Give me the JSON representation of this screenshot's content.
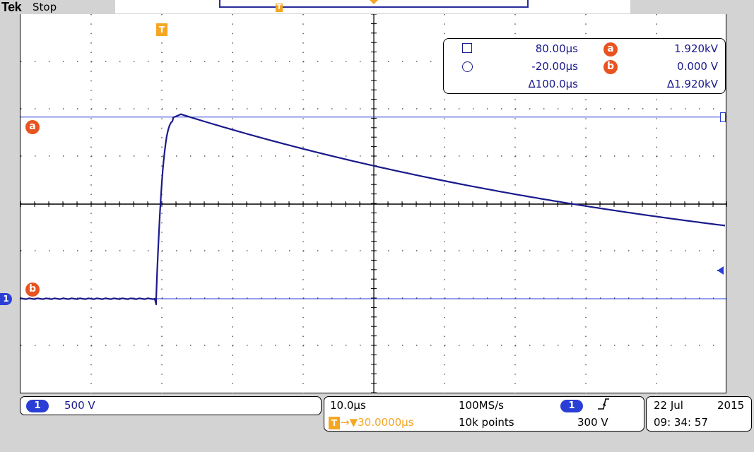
{
  "header": {
    "brand": "Tek",
    "run_state": "Stop",
    "trigger_position_marker": "T",
    "center_marker": "center-marker"
  },
  "graticule": {
    "trigger_badge": "T",
    "channel_marker": "1",
    "cursor_a_label": "a",
    "cursor_b_label": "b"
  },
  "cursor_readout": {
    "row1": {
      "icon": "square-cursor-icon",
      "time": "80.00μs",
      "badge": "a",
      "value": "1.920kV"
    },
    "row2": {
      "icon": "circle-cursor-icon",
      "time": "-20.00μs",
      "badge": "b",
      "value": "0.000 V"
    },
    "delta": {
      "time": "Δ100.0μs",
      "value": "Δ1.920kV"
    }
  },
  "channel_panel": {
    "channel": "1",
    "scale": "500 V"
  },
  "horizontal_panel": {
    "time_per_div": "10.0μs",
    "sample_rate": "100MS/s",
    "trigger_source": "1",
    "trigger_slope_icon": "rising-edge-icon",
    "trigger_level": "300 V",
    "trigger_position_badge": "T",
    "trigger_position": "→▼30.0000μs",
    "record_length": "10k points"
  },
  "datetime": {
    "date": "22 Jul",
    "year": "2015",
    "time": "09: 34: 57"
  },
  "colors": {
    "waveform": "#1a1a8c",
    "cursor_line": "#2a3ed6",
    "trigger_orange": "#f5a623",
    "cursor_badge": "#e8531f"
  },
  "waveform": {
    "volts_per_div": 500,
    "time_per_div_us": 10,
    "baseline_v": 0,
    "rise_time_us": 1.5,
    "peak_v": 1920,
    "pulse_start_us": -20,
    "value_at_end_v": 760
  }
}
